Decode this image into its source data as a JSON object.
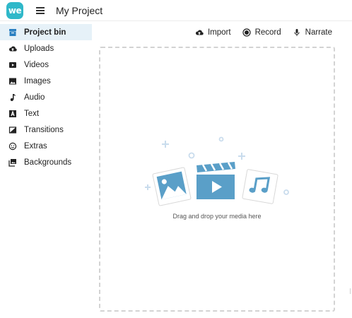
{
  "app": {
    "logo_text": "we",
    "project_title": "My Project"
  },
  "sidebar": {
    "items": [
      {
        "label": "Project bin",
        "icon": "bin-icon",
        "active": true
      },
      {
        "label": "Uploads",
        "icon": "cloud-upload-icon"
      },
      {
        "label": "Videos",
        "icon": "play-icon"
      },
      {
        "label": "Images",
        "icon": "image-icon"
      },
      {
        "label": "Audio",
        "icon": "music-note-icon"
      },
      {
        "label": "Text",
        "icon": "text-icon"
      },
      {
        "label": "Transitions",
        "icon": "transition-icon"
      },
      {
        "label": "Extras",
        "icon": "smiley-icon"
      },
      {
        "label": "Backgrounds",
        "icon": "backgrounds-icon"
      }
    ]
  },
  "toolbar": {
    "import_label": "Import",
    "record_label": "Record",
    "narrate_label": "Narrate"
  },
  "dropzone": {
    "message": "Drag and drop your media here"
  },
  "colors": {
    "accent": "#2fb8c9",
    "active_bg": "#e6f1f8",
    "illustration_blue": "#5a9fc8"
  }
}
